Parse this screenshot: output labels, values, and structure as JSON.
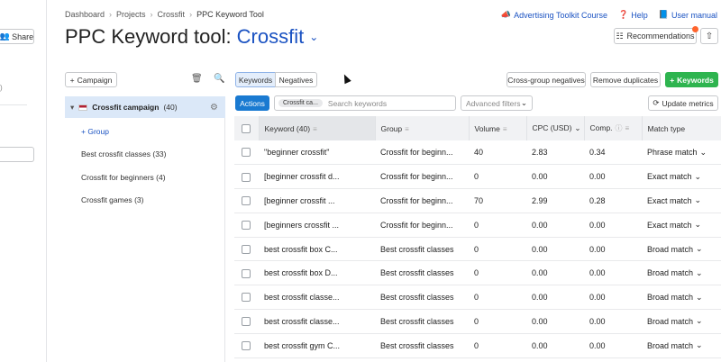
{
  "sliver": {
    "share_label": "Share",
    "mark": ")"
  },
  "breadcrumb": [
    "Dashboard",
    "Projects",
    "Crossfit",
    "PPC Keyword Tool"
  ],
  "top_links": {
    "toolkit": "Advertising Toolkit Course",
    "help": "Help",
    "manual": "User manual"
  },
  "title": {
    "prefix": "PPC Keyword tool:",
    "project": "Crossfit"
  },
  "header_buttons": {
    "recommendations": "Recommendations"
  },
  "toolbar": {
    "campaign_btn": "Campaign",
    "keywords_tab": "Keywords",
    "negatives_tab": "Negatives",
    "cross_group": "Cross-group negatives",
    "remove_dupes": "Remove duplicates",
    "add_keywords": "Keywords",
    "actions": "Actions",
    "filter_chip": "Crossfit ca...",
    "search_placeholder": "Search keywords",
    "advanced_filters": "Advanced filters",
    "update_metrics": "Update metrics"
  },
  "campaign": {
    "name": "Crossfit campaign",
    "count": "(40)",
    "add_group": "Group"
  },
  "groups": [
    {
      "label": "Best crossfit classes",
      "count": "(33)"
    },
    {
      "label": "Crossfit for beginners",
      "count": "(4)"
    },
    {
      "label": "Crossfit games",
      "count": "(3)"
    }
  ],
  "table": {
    "headers": {
      "keyword": "Keyword (40)",
      "group": "Group",
      "volume": "Volume",
      "cpc": "CPC (USD)",
      "comp": "Comp.",
      "match": "Match type"
    },
    "rows": [
      {
        "keyword": "\"beginner crossfit\"",
        "group": "Crossfit for beginn...",
        "volume": "40",
        "cpc": "2.83",
        "comp": "0.34",
        "match": "Phrase match"
      },
      {
        "keyword": "[beginner crossfit d...",
        "group": "Crossfit for beginn...",
        "volume": "0",
        "cpc": "0.00",
        "comp": "0.00",
        "match": "Exact match"
      },
      {
        "keyword": "[beginner crossfit ...",
        "group": "Crossfit for beginn...",
        "volume": "70",
        "cpc": "2.99",
        "comp": "0.28",
        "match": "Exact match"
      },
      {
        "keyword": "[beginners crossfit ...",
        "group": "Crossfit for beginn...",
        "volume": "0",
        "cpc": "0.00",
        "comp": "0.00",
        "match": "Exact match"
      },
      {
        "keyword": "best crossfit box C...",
        "group": "Best crossfit classes",
        "volume": "0",
        "cpc": "0.00",
        "comp": "0.00",
        "match": "Broad match"
      },
      {
        "keyword": "best crossfit box D...",
        "group": "Best crossfit classes",
        "volume": "0",
        "cpc": "0.00",
        "comp": "0.00",
        "match": "Broad match"
      },
      {
        "keyword": "best crossfit classe...",
        "group": "Best crossfit classes",
        "volume": "0",
        "cpc": "0.00",
        "comp": "0.00",
        "match": "Broad match"
      },
      {
        "keyword": "best crossfit classe...",
        "group": "Best crossfit classes",
        "volume": "0",
        "cpc": "0.00",
        "comp": "0.00",
        "match": "Broad match"
      },
      {
        "keyword": "best crossfit gym C...",
        "group": "Best crossfit classes",
        "volume": "0",
        "cpc": "0.00",
        "comp": "0.00",
        "match": "Broad match"
      }
    ]
  },
  "colors": {
    "accent_blue": "#1a52c2",
    "green": "#2eb44f",
    "selected_row": "#dbe8f8",
    "notify_dot": "#ff642d"
  }
}
